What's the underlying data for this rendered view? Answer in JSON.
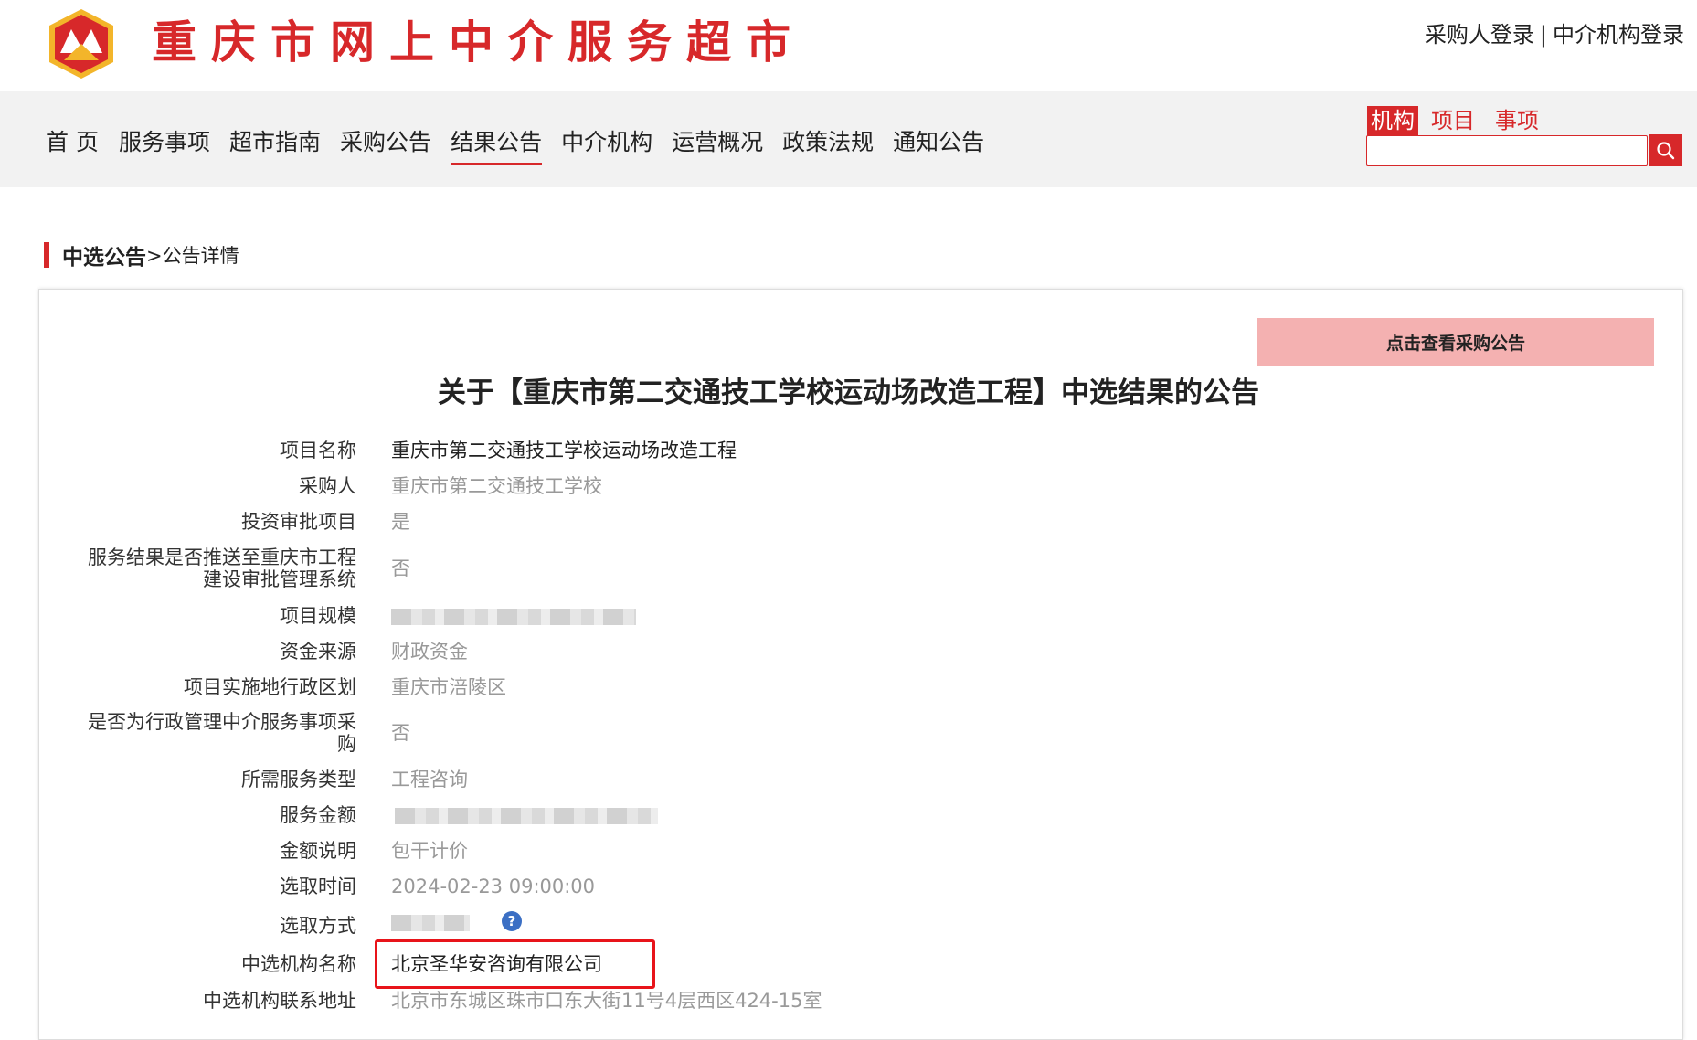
{
  "header": {
    "site_title": "重庆市网上中介服务超市",
    "login_buyer": "采购人登录",
    "login_separator": "|",
    "login_agency": "中介机构登录"
  },
  "nav": {
    "items": [
      "首页",
      "服务事项",
      "超市指南",
      "采购公告",
      "结果公告",
      "中介机构",
      "运营概况",
      "政策法规",
      "通知公告"
    ],
    "active_index": 4
  },
  "search": {
    "tabs": [
      "机构",
      "项目",
      "事项"
    ],
    "active_tab": "机构",
    "value": "",
    "placeholder": ""
  },
  "breadcrumb": {
    "main": "中选公告",
    "sub": ">公告详情"
  },
  "notice_button": "点击查看采购公告",
  "title": "关于【重庆市第二交通技工学校运动场改造工程】中选结果的公告",
  "fields": [
    {
      "label": "项目名称",
      "value": "重庆市第二交通技工学校运动场改造工程"
    },
    {
      "label": "采购人",
      "value": "重庆市第二交通技工学校"
    },
    {
      "label": "投资审批项目",
      "value": "是"
    },
    {
      "label_line1": "服务结果是否推送至重庆市工程",
      "label_line2": "建设审批管理系统",
      "value": "否"
    },
    {
      "label": "项目规模",
      "value": ""
    },
    {
      "label": "资金来源",
      "value": "财政资金"
    },
    {
      "label": "项目实施地行政区划",
      "value": "重庆市涪陵区"
    },
    {
      "label_line1": "是否为行政管理中介服务事项采",
      "label_line2": "购",
      "value": "否"
    },
    {
      "label": "所需服务类型",
      "value": "工程咨询"
    },
    {
      "label": "服务金额",
      "value": ""
    },
    {
      "label": "金额说明",
      "value": "包干计价"
    },
    {
      "label": "选取时间",
      "value": "2024-02-23 09:00:00"
    },
    {
      "label": "选取方式",
      "value": ""
    },
    {
      "label": "中选机构名称",
      "value": "北京圣华安咨询有限公司"
    },
    {
      "label": "中选机构联系地址",
      "value": "北京市东城区珠市口东大街11号4层西区424-15室"
    }
  ],
  "colors": {
    "brand_red": "#d7282a",
    "notice_button_bg": "#f4b1b1",
    "highlight_border": "#e8141a"
  }
}
